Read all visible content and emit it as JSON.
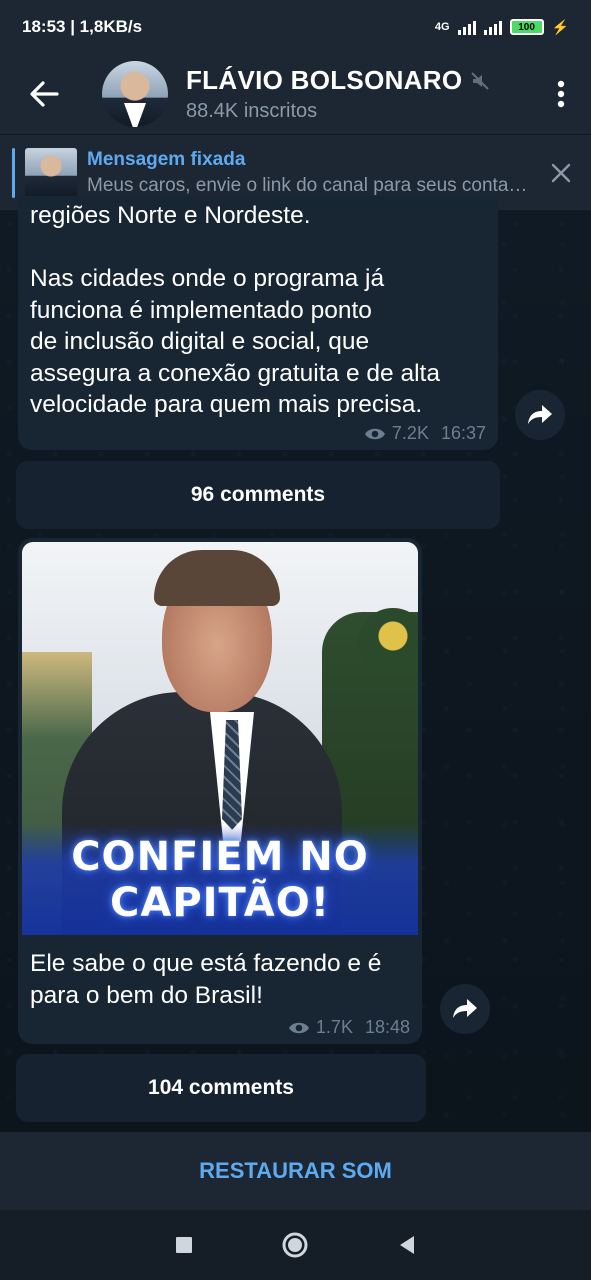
{
  "status_bar": {
    "time_speed": "18:53 | 1,8KB/s",
    "network": "4G",
    "battery": "100"
  },
  "header": {
    "channel_name": "FLÁVIO BOLSONARO",
    "subscribers": "88.4K inscritos",
    "icons": [
      "back-arrow-icon",
      "mute-icon",
      "more-vert-icon"
    ]
  },
  "pinned": {
    "title": "Mensagem fixada",
    "text": "Meus caros, envie o link do canal para seus contatos"
  },
  "messages": [
    {
      "lines": [
        "regiões Norte e Nordeste.",
        "",
        "Nas cidades onde o programa já",
        "funciona é implementado ponto",
        "de inclusão digital e social, que",
        "assegura a conexão gratuita e de alta",
        "velocidade para quem mais precisa."
      ],
      "views": "7.2K",
      "time": "16:37",
      "comments": "96 comments"
    },
    {
      "image_caption_line1": "CONFIEM NO",
      "image_caption_line2": "CAPITÃO!",
      "lines": [
        "Ele sabe o que está fazendo e é",
        "para o bem do Brasil!"
      ],
      "views": "1.7K",
      "time": "18:48",
      "comments": "104 comments"
    }
  ],
  "restore_button": "RESTAURAR SOM",
  "colors": {
    "accent": "#5eaaf0",
    "bubble": "#182533",
    "header": "#1c2733",
    "meta": "#6d7f8f"
  }
}
